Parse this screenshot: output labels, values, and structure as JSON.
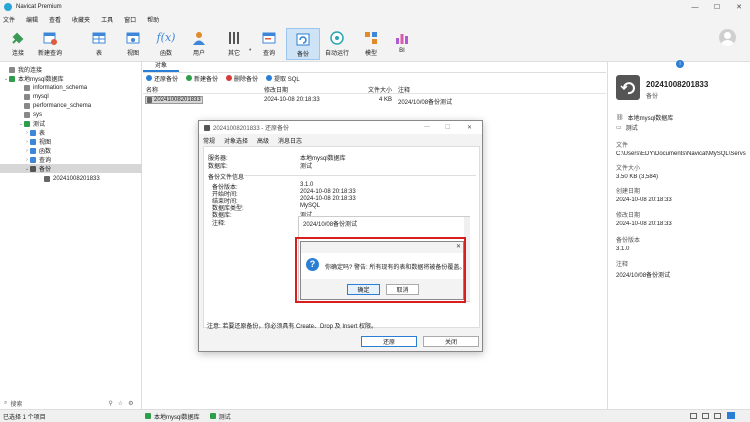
{
  "window": {
    "title": "Navicat Premium",
    "minimize": "—",
    "maximize": "☐",
    "close": "✕"
  },
  "menu": [
    "文件",
    "编辑",
    "查看",
    "收藏夹",
    "工具",
    "窗口",
    "帮助"
  ],
  "toolbar": [
    {
      "label": "连接",
      "icon": "plug-icon",
      "color": "#3b9a55"
    },
    {
      "label": "新建查询",
      "icon": "new-query-icon",
      "color": "#e05a3c"
    },
    {
      "label": "表",
      "icon": "table-icon",
      "color": "#3e87d8"
    },
    {
      "label": "视图",
      "icon": "view-icon",
      "color": "#3e87d8"
    },
    {
      "label": "函数",
      "icon": "function-icon",
      "color": "#3e87d8"
    },
    {
      "label": "用户",
      "icon": "user-icon",
      "color": "#e08a2c"
    },
    {
      "label": "其它",
      "icon": "tools-icon",
      "color": "#555"
    },
    {
      "label": "查询",
      "icon": "query-icon",
      "color": "#3e87d8"
    },
    {
      "label": "备份",
      "icon": "backup-icon",
      "color": "#2a7fd4"
    },
    {
      "label": "自动运行",
      "icon": "robot-icon",
      "color": "#2aa5b0"
    },
    {
      "label": "模型",
      "icon": "model-icon",
      "color": "#e08a2c"
    },
    {
      "label": "BI",
      "icon": "bi-icon",
      "color": "#b05ad8"
    }
  ],
  "sidebar": {
    "items": [
      {
        "label": "我的连接",
        "level": 0,
        "arrow": "",
        "color": "#888"
      },
      {
        "label": "本地mysql数据库",
        "level": 1,
        "arrow": "⌄",
        "color": "#2e9e4a"
      },
      {
        "label": "information_schema",
        "level": 2,
        "arrow": "",
        "color": "#888"
      },
      {
        "label": "mysql",
        "level": 2,
        "arrow": "",
        "color": "#888"
      },
      {
        "label": "performance_schema",
        "level": 2,
        "arrow": "",
        "color": "#888"
      },
      {
        "label": "sys",
        "level": 2,
        "arrow": "",
        "color": "#888"
      },
      {
        "label": "测试",
        "level": 2,
        "arrow": "⌄",
        "color": "#2e9e4a"
      },
      {
        "label": "表",
        "level": 3,
        "arrow": "›",
        "color": "#3e87d8"
      },
      {
        "label": "视图",
        "level": 3,
        "arrow": "›",
        "color": "#3e87d8"
      },
      {
        "label": "函数",
        "level": 3,
        "arrow": "›",
        "color": "#3e87d8"
      },
      {
        "label": "查询",
        "level": 3,
        "arrow": "›",
        "color": "#3e87d8"
      },
      {
        "label": "备份",
        "level": 3,
        "arrow": "⌄",
        "color": "#555"
      },
      {
        "label": "20241008201833",
        "level": 4,
        "arrow": "",
        "color": "#666"
      }
    ],
    "search_placeholder": "搜索"
  },
  "center": {
    "tab": "对象",
    "actions": [
      {
        "label": "还原备份",
        "color": "#2a7fd4"
      },
      {
        "label": "新建备份",
        "color": "#2e9e4a"
      },
      {
        "label": "删除备份",
        "color": "#d83a3a"
      },
      {
        "label": "提取 SQL",
        "color": "#2a7fd4"
      }
    ],
    "columns": [
      "名称",
      "修改日期",
      "文件大小",
      "注释"
    ],
    "rows": [
      {
        "name": "20241008201833",
        "date": "2024-10-08 20:18:33",
        "size": "4 KB",
        "comment": "2024/10/08备份测试"
      }
    ]
  },
  "right": {
    "title": "20241008201833",
    "subtitle": "备份",
    "conn": "本地mysql数据库",
    "db": "测试",
    "fields": [
      {
        "k": "文件",
        "v": "C:\\Users\\EDY\\Documents\\Navicat\\MySQL\\Servs"
      },
      {
        "k": "文件大小",
        "v": "3.50 KB (3,584)"
      },
      {
        "k": "创建日期",
        "v": "2024-10-08 20:18:33"
      },
      {
        "k": "修改日期",
        "v": "2024-10-08 20:18:33"
      },
      {
        "k": "备份版本",
        "v": "3.1.0"
      },
      {
        "k": "注释",
        "v": "2024/10/08备份测试"
      }
    ]
  },
  "status": {
    "left": "已选择 1 个项目",
    "conn": "本地mysql数据库",
    "db": "测试"
  },
  "restore": {
    "title": "20241008201833 - 还原备份",
    "tabs": [
      "常规",
      "对象选择",
      "高级",
      "消息日志"
    ],
    "server_k": "服务器:",
    "server_v": "本地mysql数据库",
    "db_k": "数据库:",
    "db_v": "测试",
    "section": "备份文件信息",
    "info": [
      {
        "k": "备份版本:",
        "v": "3.1.0"
      },
      {
        "k": "开始时间:",
        "v": "2024-10-08 20:18:33"
      },
      {
        "k": "结束时间:",
        "v": "2024-10-08 20:18:33"
      },
      {
        "k": "数据库类型:",
        "v": "MySQL"
      },
      {
        "k": "数据库:",
        "v": "测试"
      },
      {
        "k": "注释:",
        "v": "2024/10/08备份测试"
      }
    ],
    "note": "注意: 若要还原备份，你必须具有 Create、Drop 及 Insert 权限。",
    "ok": "还原",
    "close": "关闭"
  },
  "confirm": {
    "message": "你确定吗? 警告: 所有现有的表和数据将被备份覆盖。",
    "ok": "确定",
    "cancel": "取消",
    "close": "✕",
    "icon": "question-icon"
  }
}
